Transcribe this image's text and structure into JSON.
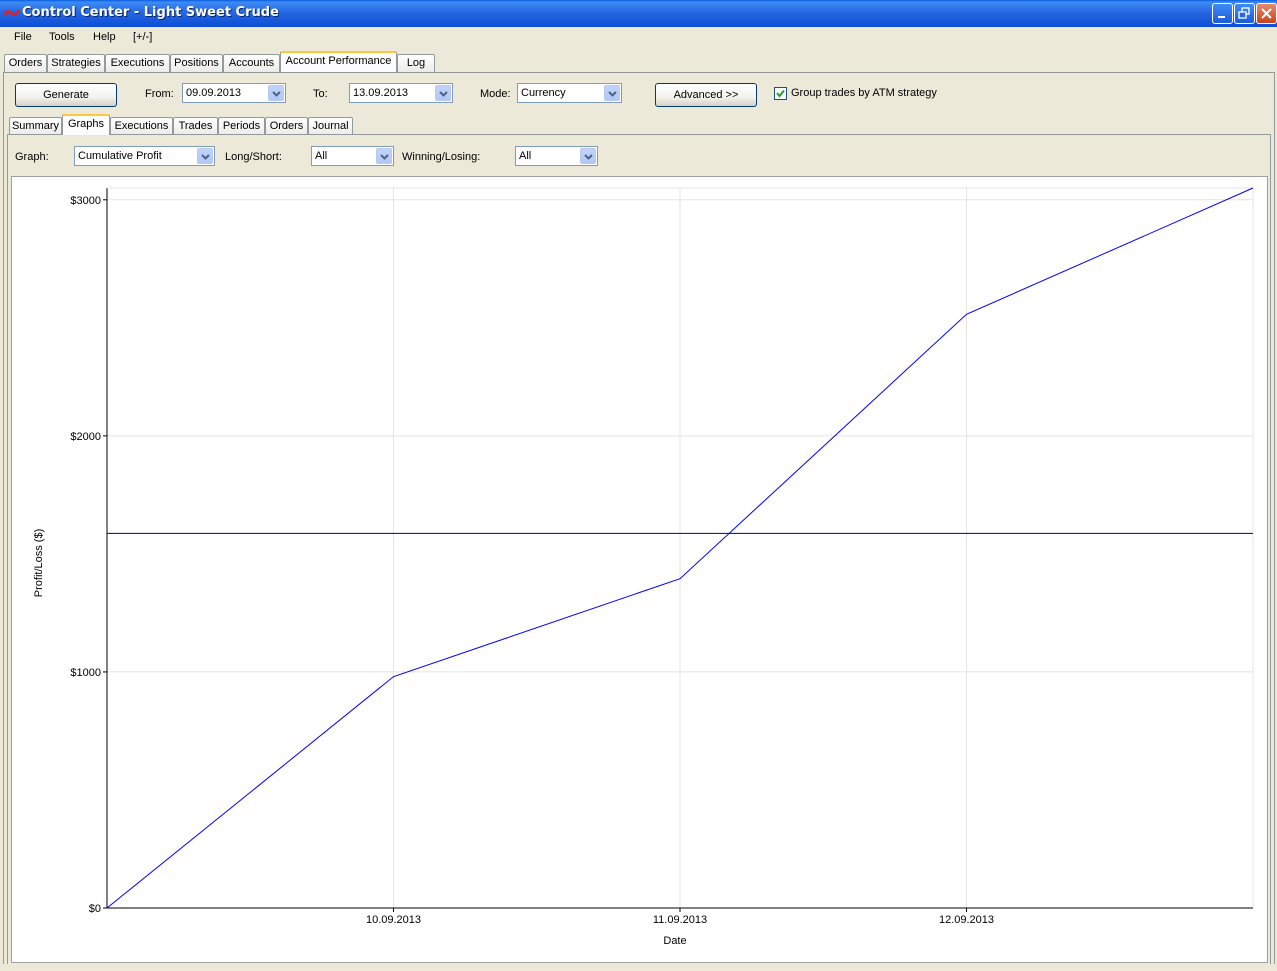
{
  "window": {
    "title": "Control Center - Light Sweet Crude"
  },
  "menu": [
    "File",
    "Tools",
    "Help",
    "[+/-]"
  ],
  "main_tabs": [
    {
      "label": "Orders",
      "active": false
    },
    {
      "label": "Strategies",
      "active": false
    },
    {
      "label": "Executions",
      "active": false
    },
    {
      "label": "Positions",
      "active": false
    },
    {
      "label": "Accounts",
      "active": false
    },
    {
      "label": "Account Performance",
      "active": true
    },
    {
      "label": "Log",
      "active": false
    }
  ],
  "toolbar": {
    "generate_label": "Generate",
    "from_label": "From:",
    "from_value": "09.09.2013",
    "to_label": "To:",
    "to_value": "13.09.2013",
    "mode_label": "Mode:",
    "mode_value": "Currency",
    "advanced_label": "Advanced >>",
    "group_trades_label": "Group trades by ATM strategy",
    "group_trades_checked": true
  },
  "sub_tabs": [
    {
      "label": "Summary",
      "active": false
    },
    {
      "label": "Graphs",
      "active": true
    },
    {
      "label": "Executions",
      "active": false
    },
    {
      "label": "Trades",
      "active": false
    },
    {
      "label": "Periods",
      "active": false
    },
    {
      "label": "Orders",
      "active": false
    },
    {
      "label": "Journal",
      "active": false
    }
  ],
  "graph_options": {
    "graph_label": "Graph:",
    "graph_value": "Cumulative Profit",
    "longshort_label": "Long/Short:",
    "longshort_value": "All",
    "winlose_label": "Winning/Losing:",
    "winlose_value": "All"
  },
  "colors": {
    "line": "#0000FF",
    "reference_line": "#000080",
    "grid": "#E4E4E4"
  },
  "chart_data": {
    "type": "line",
    "title": "",
    "xlabel": "Date",
    "ylabel": "Profit/Loss ($)",
    "x": [
      "09.09.2013",
      "10.09.2013",
      "11.09.2013",
      "12.09.2013",
      "13.09.2013"
    ],
    "xticks": [
      "10.09.2013",
      "11.09.2013",
      "12.09.2013"
    ],
    "yticks": [
      "$0",
      "$1000",
      "$2000",
      "$3000"
    ],
    "ytick_values": [
      0,
      1000,
      2000,
      3000
    ],
    "ylim": [
      0,
      3050
    ],
    "series": [
      {
        "values": [
          0,
          980,
          1395,
          2515,
          3050
        ]
      }
    ],
    "reference_line_value": 1587,
    "grid": true,
    "legend": "none"
  }
}
